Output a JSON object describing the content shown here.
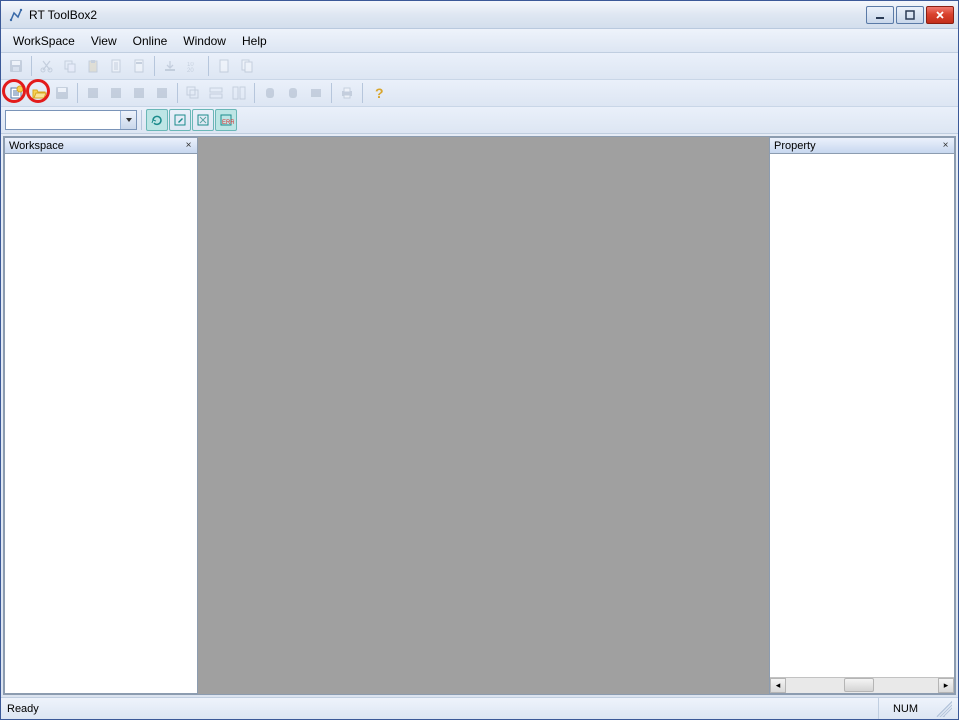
{
  "window": {
    "title": "RT ToolBox2"
  },
  "menu": {
    "workspace": "WorkSpace",
    "view": "View",
    "online": "Online",
    "window": "Window",
    "help": "Help"
  },
  "panels": {
    "workspace": {
      "title": "Workspace"
    },
    "property": {
      "title": "Property"
    }
  },
  "status": {
    "ready": "Ready",
    "num": "NUM"
  },
  "combo": {
    "value": ""
  }
}
